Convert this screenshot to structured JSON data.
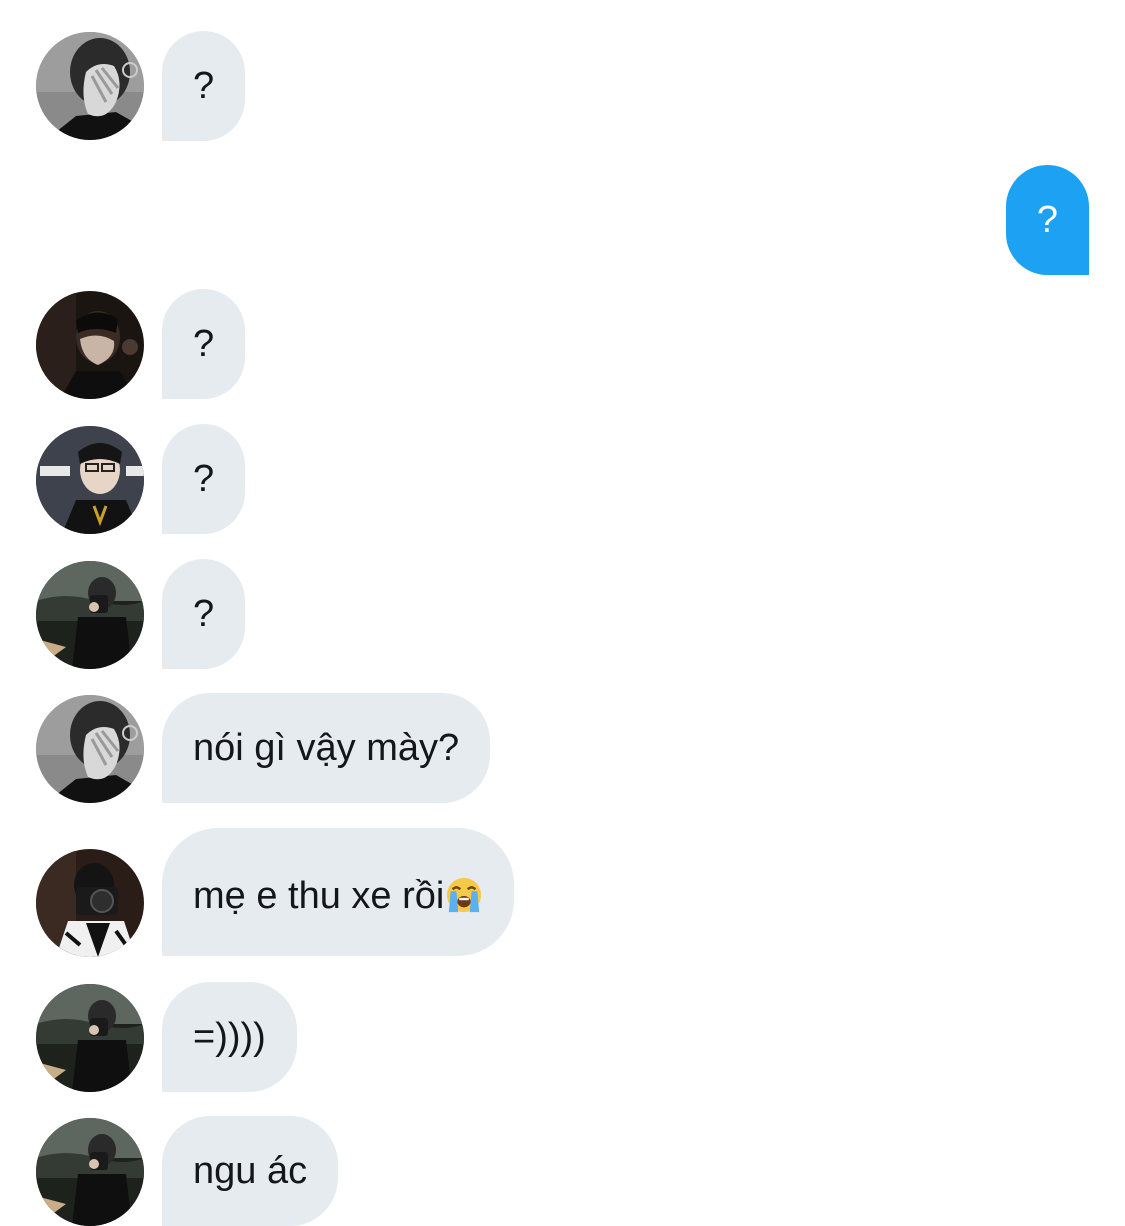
{
  "conversation": {
    "messages": [
      {
        "direction": "incoming",
        "avatar": "user-a",
        "text": "?"
      },
      {
        "direction": "outgoing",
        "text": "?"
      },
      {
        "direction": "incoming",
        "avatar": "user-b",
        "text": "?"
      },
      {
        "direction": "incoming",
        "avatar": "user-c",
        "text": "?"
      },
      {
        "direction": "incoming",
        "avatar": "user-d",
        "text": "?"
      },
      {
        "direction": "incoming",
        "avatar": "user-a",
        "text": "nói gì vậy mày?"
      },
      {
        "direction": "incoming",
        "avatar": "user-e",
        "text": "mẹ e thu xe rồi",
        "emoji": "loudly-crying-face"
      },
      {
        "direction": "incoming",
        "avatar": "user-d",
        "text": "=))))"
      },
      {
        "direction": "incoming",
        "avatar": "user-d",
        "text": "ngu ác"
      }
    ]
  },
  "colors": {
    "incoming_bubble": "#e6ebf0",
    "outgoing_bubble": "#1da1f2",
    "incoming_text": "#14171a",
    "outgoing_text": "#ffffff"
  }
}
